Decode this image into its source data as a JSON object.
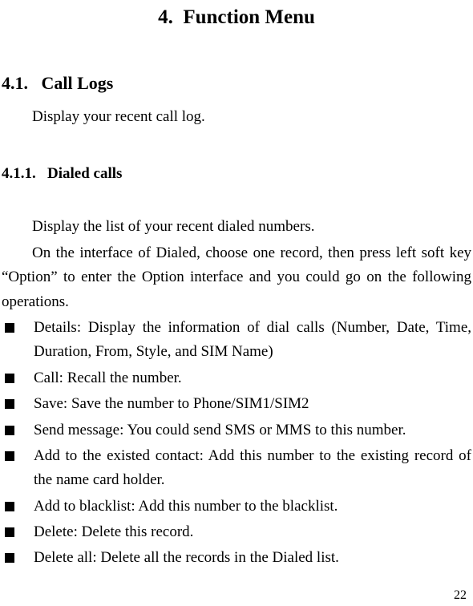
{
  "chapter": {
    "number": "4.",
    "title": "Function Menu"
  },
  "section": {
    "number": "4.1.",
    "title": "Call Logs"
  },
  "section_para": "Display your recent call log.",
  "subsection": {
    "number": "4.1.1.",
    "title": "Dialed calls"
  },
  "sub_para1": "Display the list of your recent dialed numbers.",
  "sub_para2": "On the interface of Dialed, choose one record, then press left soft key “Option” to enter the Option interface and you could go on the following operations.",
  "bullets": [
    "Details: Display the information of dial calls (Number, Date, Time, Duration, From, Style, and SIM Name)",
    "Call: Recall the number.",
    "Save: Save the number to Phone/SIM1/SIM2",
    "Send message: You could send SMS or MMS to this number.",
    "Add to the existed contact: Add this number to the existing record of the name card holder.",
    "Add to blacklist: Add this number to the blacklist.",
    "Delete: Delete this record.",
    "Delete all: Delete all the records in the Dialed list."
  ],
  "page_number": "22"
}
